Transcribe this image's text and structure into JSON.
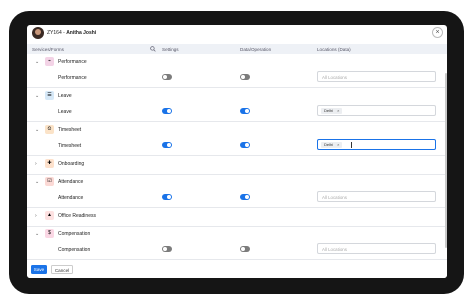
{
  "header": {
    "employee_id": "ZY164",
    "separator": " - ",
    "employee_name": "Anitha Joshi",
    "close_glyph": "×"
  },
  "columns": {
    "services": "Services/Forms",
    "settings": "Settings",
    "data": "Data/Operation",
    "locations": "Locations (Data)"
  },
  "rows": [
    {
      "category": "Performance",
      "icon": "performance-icon",
      "color": "#f3d3e6",
      "expanded": true,
      "sub": {
        "label": "Performance",
        "settings": false,
        "data": false,
        "locations_placeholder": "All Locations"
      }
    },
    {
      "category": "Leave",
      "icon": "leave-icon",
      "color": "#d6e8f7",
      "expanded": true,
      "sub": {
        "label": "Leave",
        "settings": true,
        "data": true,
        "chip": "Delhi"
      }
    },
    {
      "category": "Timesheet",
      "icon": "timesheet-icon",
      "color": "#fbe3c8",
      "expanded": true,
      "sub": {
        "label": "Timesheet",
        "settings": true,
        "data": true,
        "chip": "Delhi",
        "focused": true
      }
    },
    {
      "category": "Onboarding",
      "icon": "onboarding-icon",
      "color": "#fde1cc",
      "expanded": false
    },
    {
      "category": "Attendance",
      "icon": "attendance-icon",
      "color": "#fbd9d5",
      "expanded": true,
      "sub": {
        "label": "Attendance",
        "settings": true,
        "data": true,
        "locations_placeholder": "All Locations"
      }
    },
    {
      "category": "Office Readiness",
      "icon": "office-readiness-icon",
      "color": "#fde1e1",
      "expanded": false
    },
    {
      "category": "Compensation",
      "icon": "compensation-icon",
      "color": "#fad7e4",
      "expanded": true,
      "sub": {
        "label": "Compensation",
        "settings": false,
        "data": false,
        "locations_placeholder": "All Locations"
      }
    }
  ],
  "footer": {
    "save": "Save",
    "cancel": "Cancel"
  },
  "colors": {
    "accent": "#1a73e8",
    "toggle_off": "#7c7c7c"
  }
}
